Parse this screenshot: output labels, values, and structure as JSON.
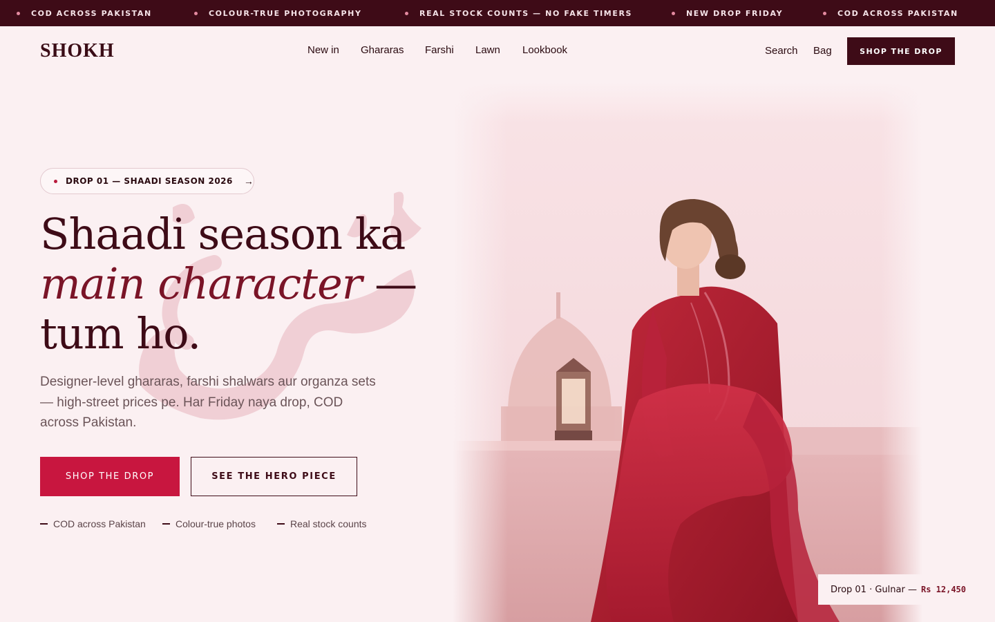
{
  "ticker": {
    "items": [
      "COD ACROSS PAKISTAN",
      "COLOUR-TRUE PHOTOGRAPHY",
      "REAL STOCK COUNTS — NO FAKE TIMERS",
      "NEW DROP FRIDAY",
      "COD ACROSS PAKISTAN"
    ]
  },
  "header": {
    "brand": "SHOKH",
    "nav": [
      "New in",
      "Ghararas",
      "Farshi",
      "Lawn",
      "Lookbook"
    ],
    "search_label": "Search",
    "bag_label": "Bag",
    "cta_label": "SHOP THE DROP"
  },
  "hero": {
    "badge": "DROP 01 — SHAADI SEASON 2026",
    "badge_arrow": "→",
    "headline_line1": "Shaadi season ka",
    "headline_line2_italic": "main character",
    "headline_line2_rest": " —",
    "headline_line3": "tum ho.",
    "lede": "Designer-level ghararas, farshi shalwars aur organza sets — high-street prices pe. Har Friday naya drop, COD across Pakistan.",
    "primary_cta": "SHOP THE DROP",
    "secondary_cta": "SEE THE HERO PIECE",
    "trust": [
      "COD across Pakistan",
      "Colour-true photos",
      "Real stock counts"
    ],
    "calligraphy": "شوخ"
  },
  "product_tag": {
    "name": "Drop 01 · Gulnar —",
    "price": "Rs 12,450"
  },
  "colors": {
    "page_bg": "#fbf0f2",
    "maroon": "#3e0b17",
    "accent": "#c8163f",
    "italic_wine": "#7a1427"
  },
  "icons": [
    "arrow-right-icon",
    "bullet-dot-icon",
    "dash-icon"
  ]
}
